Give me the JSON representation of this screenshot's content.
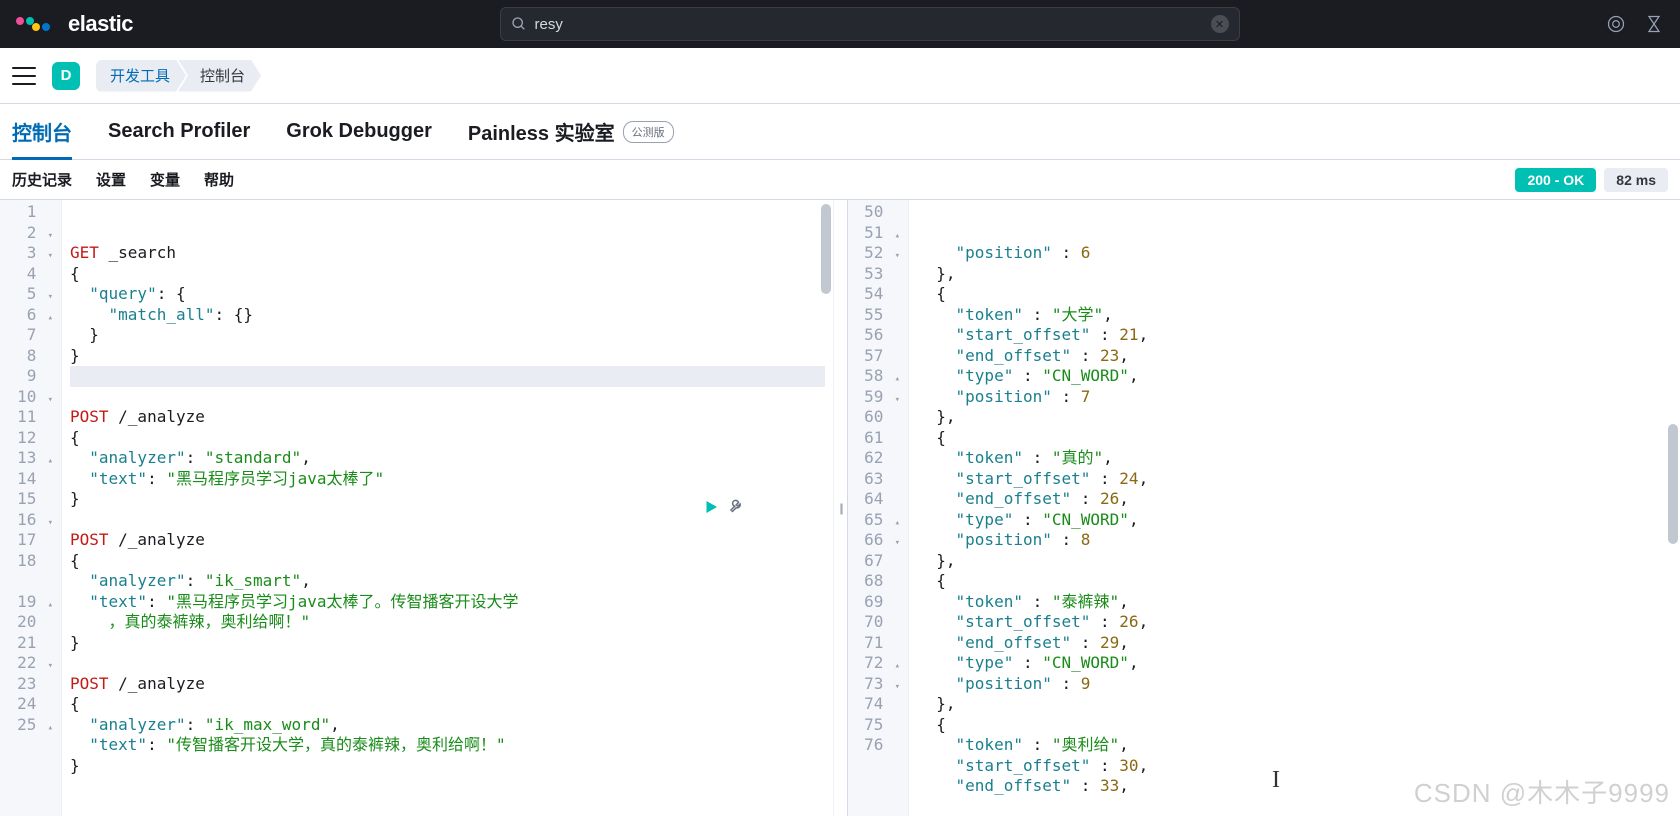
{
  "brand": "elastic",
  "search": {
    "value": "resy"
  },
  "space_letter": "D",
  "breadcrumbs": [
    "开发工具",
    "控制台"
  ],
  "tabs": [
    "控制台",
    "Search Profiler",
    "Grok Debugger",
    "Painless 实验室"
  ],
  "beta_label": "公测版",
  "sub_items": [
    "历史记录",
    "设置",
    "变量",
    "帮助"
  ],
  "status": {
    "ok": "200 - OK",
    "time": "82 ms"
  },
  "request_lines": [
    {
      "n": 1,
      "f": "",
      "h": "<span class='kw'>GET</span> _search"
    },
    {
      "n": 2,
      "f": "▾",
      "h": "{"
    },
    {
      "n": 3,
      "f": "▾",
      "h": "  <span class='key'>\"query\"</span>: {"
    },
    {
      "n": 4,
      "f": "",
      "h": "    <span class='key'>\"match_all\"</span>: {}"
    },
    {
      "n": 5,
      "f": "▾",
      "h": "  }"
    },
    {
      "n": 6,
      "f": "▴",
      "h": "}"
    },
    {
      "n": 7,
      "f": "",
      "h": "",
      "cur": true
    },
    {
      "n": 8,
      "f": "",
      "h": ""
    },
    {
      "n": 9,
      "f": "",
      "h": "<span class='kw'>POST</span> /_analyze"
    },
    {
      "n": 10,
      "f": "▾",
      "h": "{"
    },
    {
      "n": 11,
      "f": "",
      "h": "  <span class='key'>\"analyzer\"</span>: <span class='str'>\"standard\"</span>,"
    },
    {
      "n": 12,
      "f": "",
      "h": "  <span class='key'>\"text\"</span>: <span class='str'>\"黑马程序员学习java太棒了\"</span>"
    },
    {
      "n": 13,
      "f": "▴",
      "h": "}"
    },
    {
      "n": 14,
      "f": "",
      "h": ""
    },
    {
      "n": 15,
      "f": "",
      "h": "<span class='kw'>POST</span> /_analyze"
    },
    {
      "n": 16,
      "f": "▾",
      "h": "{"
    },
    {
      "n": 17,
      "f": "",
      "h": "  <span class='key'>\"analyzer\"</span>: <span class='str'>\"ik_smart\"</span>,"
    },
    {
      "n": 18,
      "f": "",
      "h": "  <span class='key'>\"text\"</span>: <span class='str'>\"黑马程序员学习java太棒了。传智播客开设大学<br>    ，真的泰裤辣，奥利给啊！\"</span>"
    },
    {
      "n": 19,
      "f": "▴",
      "h": "}"
    },
    {
      "n": 20,
      "f": "",
      "h": ""
    },
    {
      "n": 21,
      "f": "",
      "h": "<span class='kw'>POST</span> /_analyze"
    },
    {
      "n": 22,
      "f": "▾",
      "h": "{"
    },
    {
      "n": 23,
      "f": "",
      "h": "  <span class='key'>\"analyzer\"</span>: <span class='str'>\"ik_max_word\"</span>,"
    },
    {
      "n": 24,
      "f": "",
      "h": "  <span class='key'>\"text\"</span>: <span class='str'>\"传智播客开设大学，真的泰裤辣，奥利给啊！\"</span>"
    },
    {
      "n": 25,
      "f": "▴",
      "h": "}"
    }
  ],
  "response_lines": [
    {
      "n": 50,
      "f": "",
      "h": "    <span class='key'>\"position\"</span> : <span class='num'>6</span>"
    },
    {
      "n": 51,
      "f": "▴",
      "h": "  },"
    },
    {
      "n": 52,
      "f": "▾",
      "h": "  {"
    },
    {
      "n": 53,
      "f": "",
      "h": "    <span class='key'>\"token\"</span> : <span class='str'>\"大学\"</span>,"
    },
    {
      "n": 54,
      "f": "",
      "h": "    <span class='key'>\"start_offset\"</span> : <span class='num'>21</span>,"
    },
    {
      "n": 55,
      "f": "",
      "h": "    <span class='key'>\"end_offset\"</span> : <span class='num'>23</span>,"
    },
    {
      "n": 56,
      "f": "",
      "h": "    <span class='key'>\"type\"</span> : <span class='str'>\"CN_WORD\"</span>,"
    },
    {
      "n": 57,
      "f": "",
      "h": "    <span class='key'>\"position\"</span> : <span class='num'>7</span>"
    },
    {
      "n": 58,
      "f": "▴",
      "h": "  },"
    },
    {
      "n": 59,
      "f": "▾",
      "h": "  {"
    },
    {
      "n": 60,
      "f": "",
      "h": "    <span class='key'>\"token\"</span> : <span class='str'>\"真的\"</span>,"
    },
    {
      "n": 61,
      "f": "",
      "h": "    <span class='key'>\"start_offset\"</span> : <span class='num'>24</span>,"
    },
    {
      "n": 62,
      "f": "",
      "h": "    <span class='key'>\"end_offset\"</span> : <span class='num'>26</span>,"
    },
    {
      "n": 63,
      "f": "",
      "h": "    <span class='key'>\"type\"</span> : <span class='str'>\"CN_WORD\"</span>,"
    },
    {
      "n": 64,
      "f": "",
      "h": "    <span class='key'>\"position\"</span> : <span class='num'>8</span>"
    },
    {
      "n": 65,
      "f": "▴",
      "h": "  },"
    },
    {
      "n": 66,
      "f": "▾",
      "h": "  {"
    },
    {
      "n": 67,
      "f": "",
      "h": "    <span class='key'>\"token\"</span> : <span class='str'>\"泰裤辣\"</span>,"
    },
    {
      "n": 68,
      "f": "",
      "h": "    <span class='key'>\"start_offset\"</span> : <span class='num'>26</span>,"
    },
    {
      "n": 69,
      "f": "",
      "h": "    <span class='key'>\"end_offset\"</span> : <span class='num'>29</span>,"
    },
    {
      "n": 70,
      "f": "",
      "h": "    <span class='key'>\"type\"</span> : <span class='str'>\"CN_WORD\"</span>,"
    },
    {
      "n": 71,
      "f": "",
      "h": "    <span class='key'>\"position\"</span> : <span class='num'>9</span>"
    },
    {
      "n": 72,
      "f": "▴",
      "h": "  },"
    },
    {
      "n": 73,
      "f": "▾",
      "h": "  {"
    },
    {
      "n": 74,
      "f": "",
      "h": "    <span class='key'>\"token\"</span> : <span class='str'>\"奥利给\"</span>,"
    },
    {
      "n": 75,
      "f": "",
      "h": "    <span class='key'>\"start_offset\"</span> : <span class='num'>30</span>,"
    },
    {
      "n": 76,
      "f": "",
      "h": "    <span class='key'>\"end_offset\"</span> : <span class='num'>33</span>,"
    }
  ],
  "watermark": "CSDN @木木子9999"
}
